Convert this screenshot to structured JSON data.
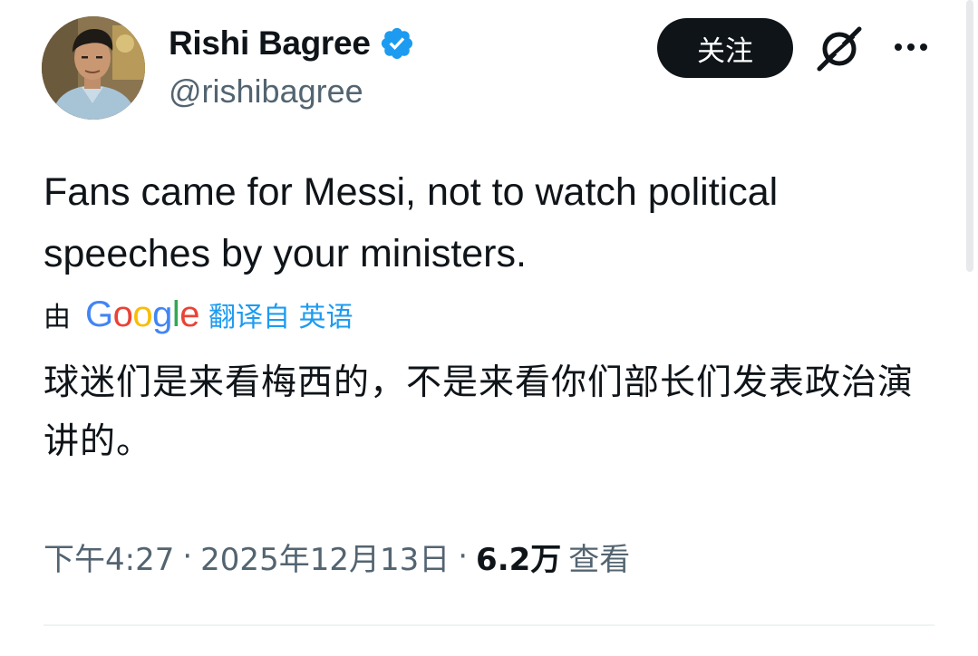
{
  "author": {
    "display_name": "Rishi Bagree",
    "handle": "@rishibagree",
    "verified_icon": "verified-badge-icon",
    "verified_color": "#1d9bf0"
  },
  "actions": {
    "follow_label": "关注",
    "grok_icon": "grok-icon",
    "more_icon": "more-horizontal-icon"
  },
  "tweet": {
    "text": "Fans came for Messi, not to watch political speeches by your ministers."
  },
  "translation": {
    "by_label": "由",
    "provider": "Google",
    "translated_from": "翻译自 英语",
    "text": "球迷们是来看梅西的，不是来看你们部长们发表政治演讲的。"
  },
  "meta": {
    "time": "下午4:27",
    "separator": "·",
    "date": "2025年12月13日",
    "views_count": "6.2万",
    "views_label": "查看"
  },
  "colors": {
    "text_primary": "#0f1419",
    "text_secondary": "#536471",
    "accent": "#1d9bf0",
    "button_bg": "#0f1419"
  }
}
